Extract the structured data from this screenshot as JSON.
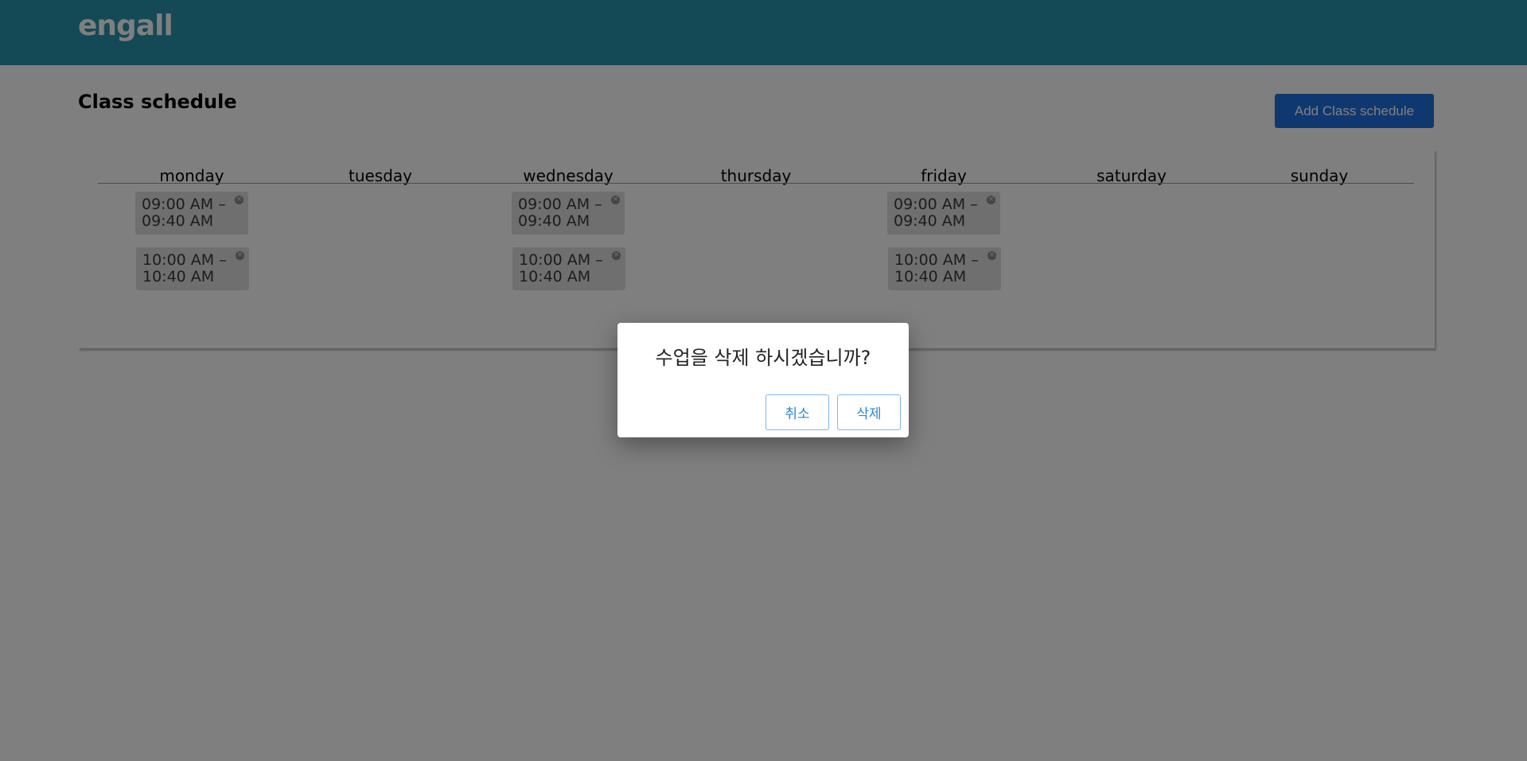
{
  "header": {
    "logo_text": "engall"
  },
  "main": {
    "title": "Class schedule",
    "add_button_label": "Add Class schedule"
  },
  "schedule": {
    "days": [
      "monday",
      "tuesday",
      "wednesday",
      "thursday",
      "friday",
      "saturday",
      "sunday"
    ],
    "monday": [
      {
        "start": "09:00 AM –",
        "end": "09:40 AM"
      },
      {
        "start": "10:00 AM –",
        "end": "10:40 AM"
      }
    ],
    "wednesday": [
      {
        "start": "09:00 AM –",
        "end": "09:40 AM"
      },
      {
        "start": "10:00 AM –",
        "end": "10:40 AM"
      }
    ],
    "friday": [
      {
        "start": "09:00 AM –",
        "end": "09:40 AM"
      },
      {
        "start": "10:00 AM –",
        "end": "10:40 AM"
      }
    ],
    "remove_icon": "close-circle-icon"
  },
  "modal": {
    "message": "수업을 삭제 하시겠습니까?",
    "cancel_label": "취소",
    "delete_label": "삭제"
  },
  "colors": {
    "header_bg": "#2794ad",
    "primary_button": "#1f6fe0",
    "modal_button_text": "#2b87d6"
  }
}
